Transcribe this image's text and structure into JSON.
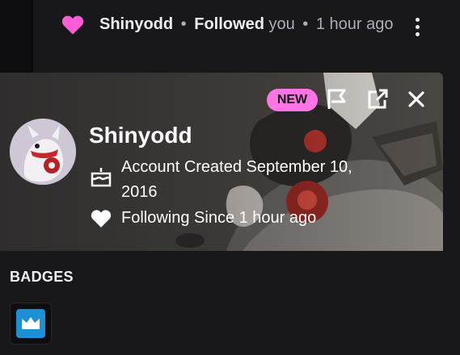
{
  "notification": {
    "username": "Shinyodd",
    "separator": "•",
    "action": "Followed",
    "object": "you",
    "separator2": "•",
    "time": "1 hour ago"
  },
  "card": {
    "new_label": "NEW",
    "username": "Shinyodd",
    "account_created": "Account Created September 10, 2016",
    "following_since": "Following Since 1 hour ago"
  },
  "badges": {
    "title": "BADGES"
  },
  "colors": {
    "accent_pink": "#ff75e6",
    "heart": "#ff5cd6",
    "badge_blue": "#1f8fd3",
    "background": "#18181b"
  },
  "icons": [
    "heart-icon",
    "more-options-icon",
    "flag-icon",
    "popout-icon",
    "close-icon",
    "cake-icon",
    "heart-white-icon",
    "crown-badge-icon"
  ]
}
